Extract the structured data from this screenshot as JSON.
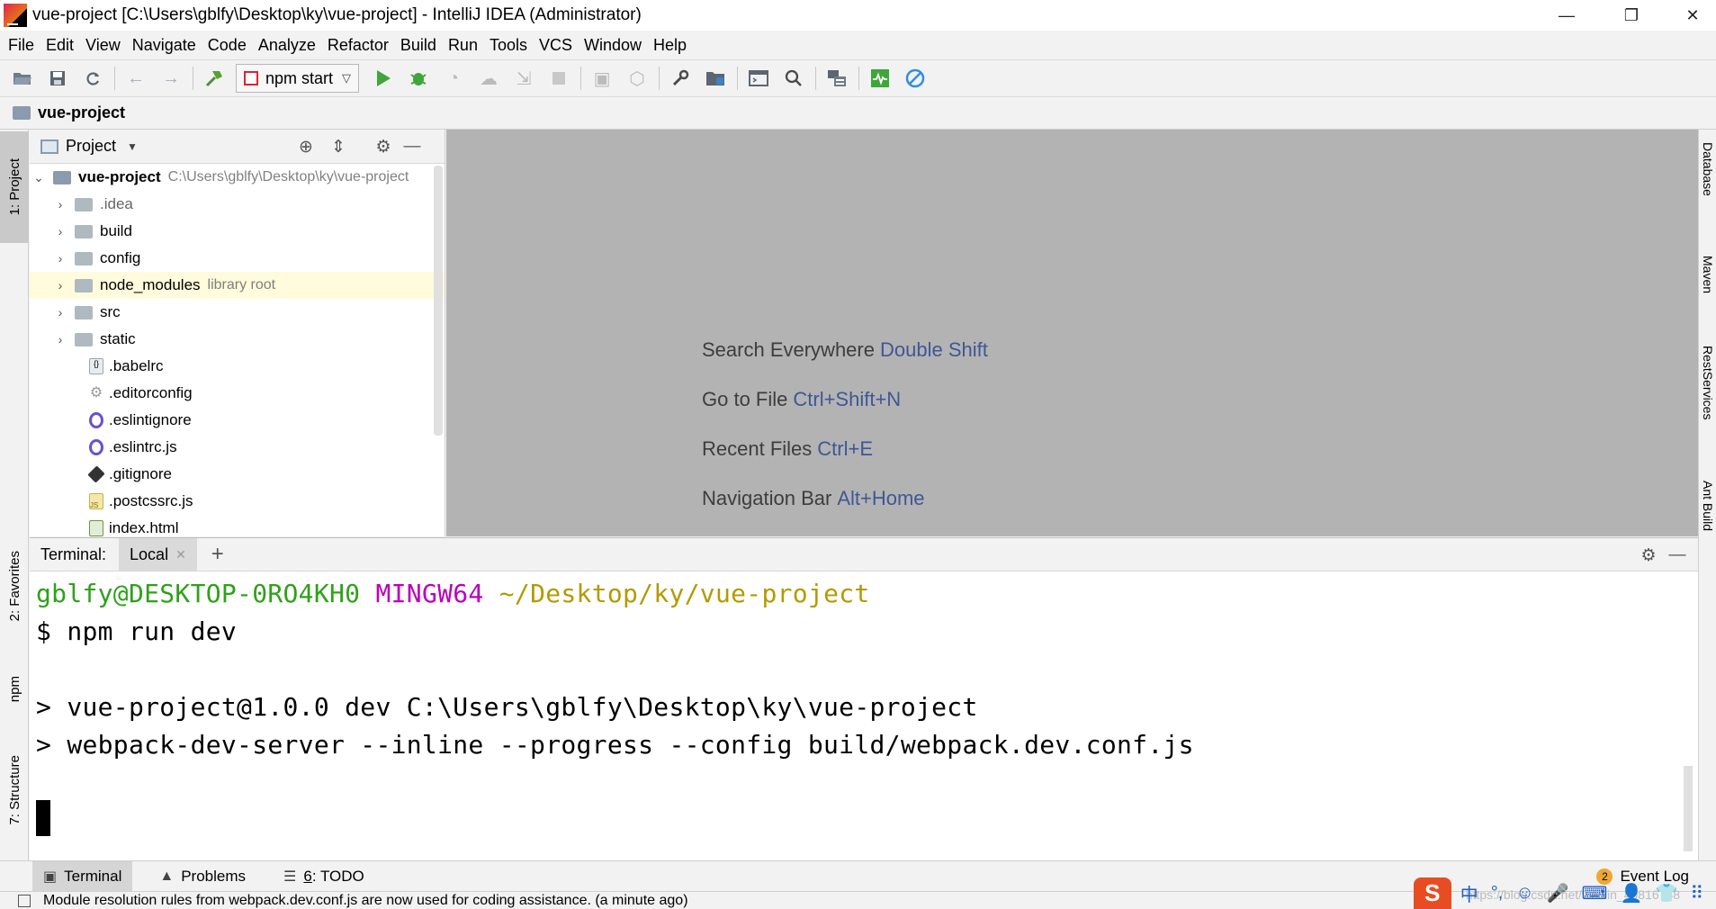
{
  "window": {
    "title": "vue-project [C:\\Users\\gblfy\\Desktop\\ky\\vue-project] - IntelliJ IDEA (Administrator)",
    "controls": {
      "minimize": "—",
      "restore": "❐",
      "close": "✕"
    }
  },
  "menu": [
    "File",
    "Edit",
    "View",
    "Navigate",
    "Code",
    "Analyze",
    "Refactor",
    "Build",
    "Run",
    "Tools",
    "VCS",
    "Window",
    "Help"
  ],
  "toolbar": {
    "run_config": "npm start",
    "icons": [
      "open-icon",
      "save-icon",
      "sync-icon",
      "back-icon",
      "forward-icon",
      "build-icon",
      "run-icon",
      "debug-icon",
      "coverage-icon",
      "profile-icon",
      "attach-icon",
      "stop-icon",
      "project-structure-icon",
      "settings-icon",
      "wrench-icon",
      "folder-icon",
      "terminal-icon",
      "search-icon",
      "vcs-icon",
      "monitor-icon",
      "block-icon"
    ]
  },
  "navbar": {
    "project": "vue-project"
  },
  "left_stripe": {
    "project": "1: Project",
    "favorites": "2: Favorites",
    "npm": "npm",
    "structure": "7: Structure"
  },
  "right_stripe": {
    "database": "Database",
    "maven": "Maven",
    "rest": "RestServices",
    "ant": "Ant Build"
  },
  "project_panel": {
    "title": "Project",
    "root": {
      "name": "vue-project",
      "path": "C:\\Users\\gblfy\\Desktop\\ky\\vue-project"
    },
    "items": [
      {
        "name": ".idea",
        "type": "folder",
        "icon": "folder-icon"
      },
      {
        "name": "build",
        "type": "folder",
        "icon": "folder-icon"
      },
      {
        "name": "config",
        "type": "folder",
        "icon": "folder-icon"
      },
      {
        "name": "node_modules",
        "type": "folder",
        "hint": "library root",
        "icon": "folder-icon"
      },
      {
        "name": "src",
        "type": "folder",
        "icon": "folder-icon"
      },
      {
        "name": "static",
        "type": "folder",
        "icon": "folder-icon"
      },
      {
        "name": ".babelrc",
        "type": "file",
        "icon": "json-file-icon"
      },
      {
        "name": ".editorconfig",
        "type": "file",
        "icon": "gear-file-icon"
      },
      {
        "name": ".eslintignore",
        "type": "file",
        "icon": "eslint-icon"
      },
      {
        "name": ".eslintrc.js",
        "type": "file",
        "icon": "eslint-icon"
      },
      {
        "name": ".gitignore",
        "type": "file",
        "icon": "git-icon"
      },
      {
        "name": ".postcssrc.js",
        "type": "file",
        "icon": "js-file-icon"
      },
      {
        "name": "index.html",
        "type": "file",
        "icon": "html-file-icon"
      }
    ]
  },
  "editor_hints": [
    {
      "label": "Search Everywhere",
      "key": "Double Shift"
    },
    {
      "label": "Go to File",
      "key": "Ctrl+Shift+N"
    },
    {
      "label": "Recent Files",
      "key": "Ctrl+E"
    },
    {
      "label": "Navigation Bar",
      "key": "Alt+Home"
    }
  ],
  "terminal": {
    "label": "Terminal:",
    "tab": "Local",
    "prompt_user": "gblfy@DESKTOP-0RO4KH0",
    "prompt_env": "MINGW64",
    "prompt_path": "~/Desktop/ky/vue-project",
    "command": "$ npm run dev",
    "output1": "> vue-project@1.0.0 dev C:\\Users\\gblfy\\Desktop\\ky\\vue-project",
    "output2": "> webpack-dev-server --inline --progress --config build/webpack.dev.conf.js"
  },
  "bottom_tabs": {
    "terminal": "Terminal",
    "problems": "Problems",
    "todo_num": "6",
    "todo": ": TODO",
    "event_log": "Event Log",
    "event_count": "2"
  },
  "status": {
    "message": "Module resolution rules from webpack.dev.conf.js are now used for coding assistance. (a minute ago)"
  },
  "tray": {
    "ime_logo": "S",
    "ime_lang": "中",
    "watermark": "https://blog.csdn.net/weixin_40816738"
  },
  "colors": {
    "prompt_green": "#2fa11a",
    "prompt_magenta": "#bb00bb",
    "prompt_yellow": "#b49a00",
    "hint_key": "#3e5796",
    "editor_bg": "#b3b3b3"
  }
}
